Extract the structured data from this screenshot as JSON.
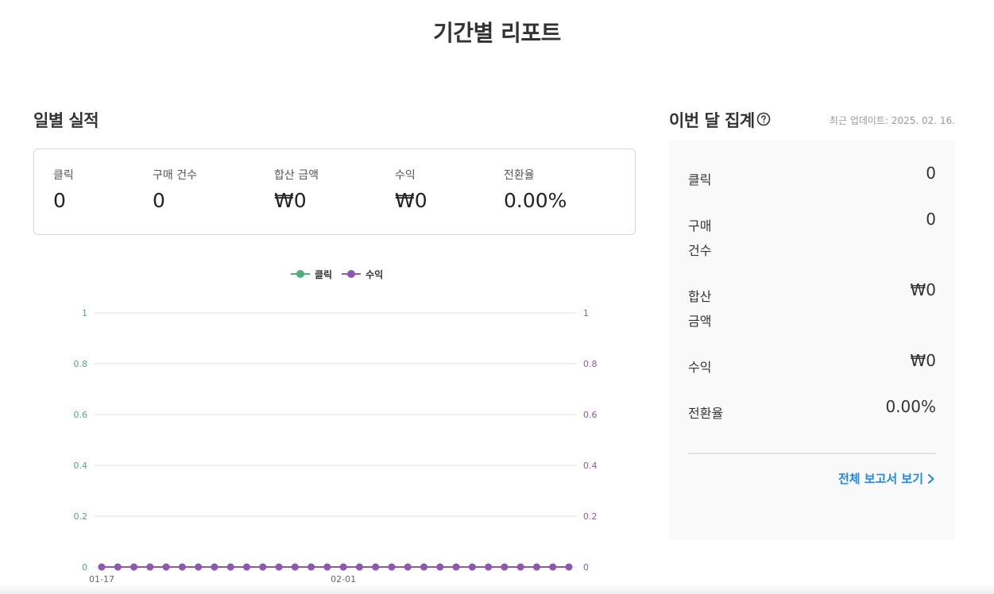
{
  "page": {
    "title": "기간별 리포트"
  },
  "daily": {
    "title": "일별 실적",
    "metrics": [
      {
        "label": "클릭",
        "value": "0"
      },
      {
        "label": "구매 건수",
        "value": "0"
      },
      {
        "label": "합산 금액",
        "value": "₩0"
      },
      {
        "label": "수익",
        "value": "₩0"
      },
      {
        "label": "전환율",
        "value": "0.00%"
      }
    ]
  },
  "monthly": {
    "title": "이번 달 집계",
    "help_icon": "question-circle-icon",
    "updated": "최근 업데이트: 2025. 02. 16.",
    "rows": [
      {
        "label": "클릭",
        "value": "0"
      },
      {
        "label": "구매\n건수",
        "value": "0"
      },
      {
        "label": "합산\n금액",
        "value": "₩0"
      },
      {
        "label": "수익",
        "value": "₩0"
      },
      {
        "label": "전환율",
        "value": "0.00%"
      }
    ],
    "full_report_label": "전체 보고서 보기",
    "full_report_icon": "chevron-right-icon"
  },
  "colors": {
    "click": "#4caf7a",
    "revenue": "#8e57b3",
    "link": "#1e88e5"
  },
  "chart_data": {
    "type": "line",
    "x": [
      "01-17",
      "01-18",
      "01-19",
      "01-20",
      "01-21",
      "01-22",
      "01-23",
      "01-24",
      "01-25",
      "01-26",
      "01-27",
      "01-28",
      "01-29",
      "01-30",
      "01-31",
      "02-01",
      "02-02",
      "02-03",
      "02-04",
      "02-05",
      "02-06",
      "02-07",
      "02-08",
      "02-09",
      "02-10",
      "02-11",
      "02-12",
      "02-13",
      "02-14",
      "02-15"
    ],
    "x_tick_labels": [
      "01-17",
      "02-01"
    ],
    "series": [
      {
        "name": "클릭",
        "axis": "left",
        "color": "#4caf7a",
        "values": [
          0,
          0,
          0,
          0,
          0,
          0,
          0,
          0,
          0,
          0,
          0,
          0,
          0,
          0,
          0,
          0,
          0,
          0,
          0,
          0,
          0,
          0,
          0,
          0,
          0,
          0,
          0,
          0,
          0,
          0
        ]
      },
      {
        "name": "수익",
        "axis": "right",
        "color": "#8e57b3",
        "values": [
          0,
          0,
          0,
          0,
          0,
          0,
          0,
          0,
          0,
          0,
          0,
          0,
          0,
          0,
          0,
          0,
          0,
          0,
          0,
          0,
          0,
          0,
          0,
          0,
          0,
          0,
          0,
          0,
          0,
          0
        ]
      }
    ],
    "ylim_left": [
      0,
      1
    ],
    "ylim_right": [
      0,
      1
    ],
    "y_ticks": [
      "0",
      "0.2",
      "0.4",
      "0.6",
      "0.8",
      "1"
    ],
    "grid": true,
    "legend": "top"
  }
}
